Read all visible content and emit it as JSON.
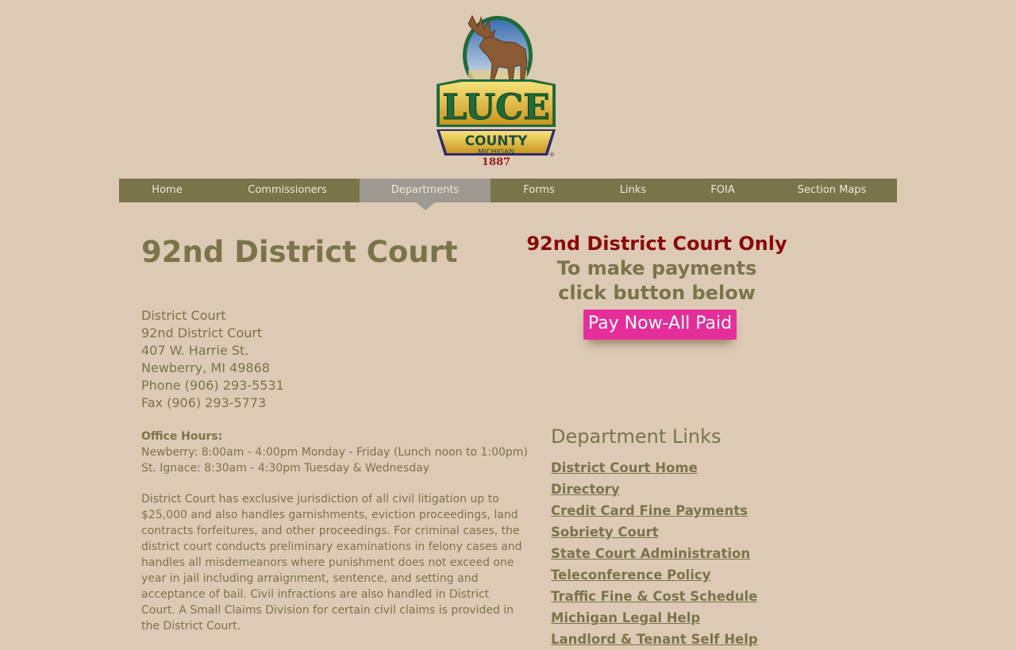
{
  "logo": {
    "name": "LUCE",
    "county": "COUNTY",
    "state": "MICHIGAN",
    "year": "1887",
    "reg": "®"
  },
  "nav": {
    "items": [
      {
        "label": "Home"
      },
      {
        "label": "Commissioners"
      },
      {
        "label": "Departments",
        "active": true
      },
      {
        "label": "Forms"
      },
      {
        "label": "Links"
      },
      {
        "label": "FOIA"
      },
      {
        "label": "Section Maps"
      }
    ]
  },
  "page": {
    "title": "92nd District Court"
  },
  "address": {
    "lines": [
      "District Court",
      "92nd District Court",
      "407 W. Harrie St.",
      "Newberry, MI 49868",
      "Phone (906) 293-5531",
      "Fax (906) 293-5773"
    ]
  },
  "hours": {
    "label": "Office Hours:",
    "lines": [
      "Newberry: 8:00am - 4:00pm Monday - Friday (Lunch noon to 1:00pm)",
      "St. Ignace: 8:30am - 4:30pm Tuesday & Wednesday"
    ]
  },
  "description": "District Court has exclusive jurisdiction of all civil litigation up to $25,000 and also handles garnishments, eviction proceedings, land contracts forfeitures, and other proceedings. For criminal cases, the district court conducts preliminary examinations in felony cases and handles all misdemeanors where punishment does not exceed one year in jail including arraignment, sentence, and setting and acceptance of bail. Civil infractions are also handled in District Court. A Small Claims Division for certain civil claims is provided in the District Court.",
  "payment": {
    "only": "92nd District Court Only",
    "line1": "To make payments",
    "line2": "click button below",
    "button": "Pay Now-All Paid"
  },
  "department_links": {
    "title": "Department Links",
    "items": [
      "District Court Home",
      "Directory",
      "Credit Card Fine Payments",
      "Sobriety Court",
      "State Court Administration",
      "Teleconference Policy",
      "Traffic Fine & Cost Schedule",
      "Michigan Legal Help",
      "Landlord & Tenant Self Help"
    ]
  },
  "colors": {
    "background": "#dccab5",
    "nav": "#7a744a",
    "nav_active": "#9d9a92",
    "text": "#7a744a",
    "accent_red": "#8b0a0a",
    "pay_button": "#e62e9a"
  }
}
